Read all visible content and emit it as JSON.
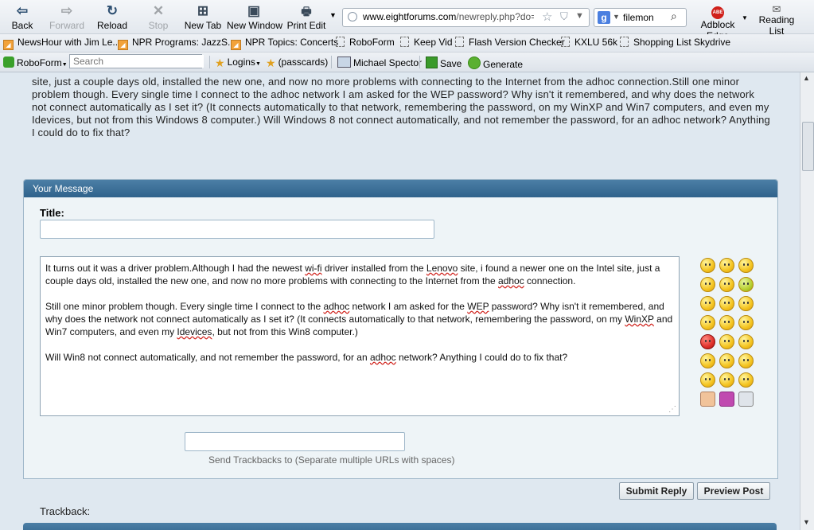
{
  "toolbar": {
    "back": "Back",
    "forward": "Forward",
    "reload": "Reload",
    "stop": "Stop",
    "new_tab": "New Tab",
    "new_window": "New Window",
    "print_edit": "Print Edit",
    "url_host": "www.eightforums.com",
    "url_path": "/newreply.php?do=pos",
    "search_value": "filemon",
    "adblock": "Adblock Edge",
    "adblock_badge": "ABE",
    "reading_list": "Reading List"
  },
  "bookmarks": [
    {
      "label": "NewsHour with Jim Le...",
      "icon": "rss-icon"
    },
    {
      "label": "NPR Programs: JazzS...",
      "icon": "rss-icon"
    },
    {
      "label": "NPR Topics: Concerts",
      "icon": "rss-icon"
    },
    {
      "label": "RoboForm",
      "icon": "page-icon"
    },
    {
      "label": "Keep Vid",
      "icon": "page-icon"
    },
    {
      "label": "Flash Version Checker",
      "icon": "page-icon"
    },
    {
      "label": "KXLU 56k",
      "icon": "page-icon"
    },
    {
      "label": "Shopping List Skydrive",
      "icon": "page-icon"
    }
  ],
  "roboform": {
    "brand": "RoboForm",
    "search_placeholder": "Search",
    "logins": "Logins",
    "passcards": "(passcards)",
    "identity": "Michael Spector",
    "save": "Save",
    "generate": "Generate"
  },
  "page": {
    "quoted_text": "site, just a couple days old, installed the new one, and now no more problems with connecting to the Internet from the adhoc connection.Still one minor problem though. Every single time I connect to the adhoc network I am asked for the WEP password? Why isn't it remembered, and why does the network not connect automatically as I set it? (It connects automatically to that network, remembering the password, on my WinXP and Win7 computers, and even my Idevices, but not from this Windows 8 computer.) Will Windows 8 not connect automatically, and not remember the password, for an adhoc network? Anything I could do to fix that?",
    "panel_title": "Your Message",
    "title_label": "Title:",
    "title_value": "",
    "message": {
      "p1_a": "It turns out it was a driver problem.Although I had the newest ",
      "p1_sq1": "wi-fi",
      "p1_b": " driver installed from the ",
      "p1_sq2": "Lenovo",
      "p1_c": " site, i found a newer one on the Intel site, just a couple days old, installed the new one, and now no more problems with connecting to the Internet from the ",
      "p1_sq3": "adhoc",
      "p1_d": " connection.",
      "p2_a": "Still one minor problem though. Every single time I connect to the ",
      "p2_sq1": "adhoc",
      "p2_b": " network I am asked for the ",
      "p2_sq2": "WEP",
      "p2_c": " password? Why isn't it remembered, and why does the network not connect automatically as I set it? (It connects automatically to that network, remembering the password, on my ",
      "p2_sq3": "WinXP",
      "p2_d": " and Win7 computers, and even my ",
      "p2_sq4": "Idevices",
      "p2_e": ", but not from this Win8 computer.)",
      "p3_a": "Will Win8 not connect automatically, and not remember the password, for an ",
      "p3_sq1": "adhoc",
      "p3_b": " network? Anything I could do to fix that?"
    },
    "trackback_label": "Trackback:",
    "trackback_value": "",
    "trackback_hint": "Send Trackbacks to (Separate multiple URLs with spaces)",
    "submit": "Submit Reply",
    "preview": "Preview Post"
  },
  "colors": {
    "panel_header": "#3a6e96",
    "page_bg": "#dfe8f0",
    "squiggle": "#d0201a"
  }
}
